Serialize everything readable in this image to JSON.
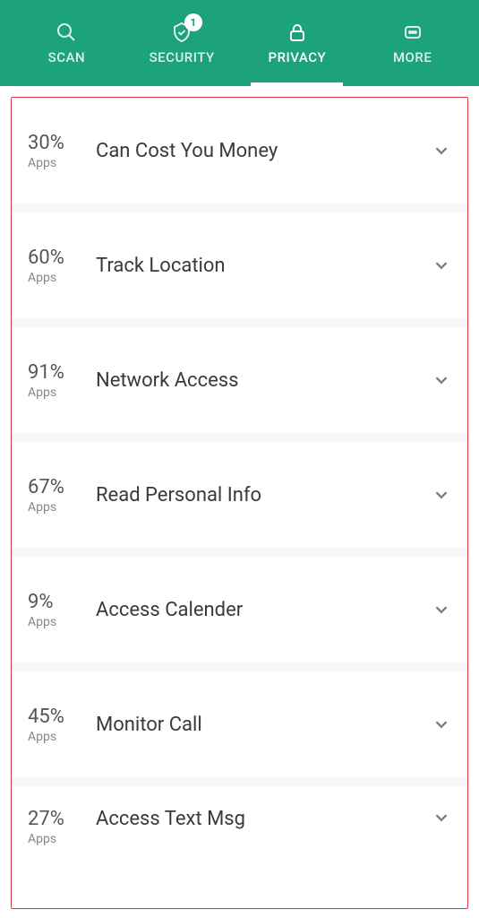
{
  "header": {
    "tabs": [
      {
        "key": "scan",
        "label": "SCAN",
        "badge": null
      },
      {
        "key": "security",
        "label": "SECURITY",
        "badge": "1"
      },
      {
        "key": "privacy",
        "label": "PRIVACY",
        "badge": null
      },
      {
        "key": "more",
        "label": "MORE",
        "badge": null
      }
    ],
    "active_tab": "privacy"
  },
  "list": {
    "apps_label": "Apps",
    "items": [
      {
        "pct": "30%",
        "title": "Can Cost You Money"
      },
      {
        "pct": "60%",
        "title": "Track Location"
      },
      {
        "pct": "91%",
        "title": "Network Access"
      },
      {
        "pct": "67%",
        "title": "Read Personal Info"
      },
      {
        "pct": "9%",
        "title": "Access Calender"
      },
      {
        "pct": "45%",
        "title": "Monitor Call"
      },
      {
        "pct": "27%",
        "title": "Access Text Msg"
      }
    ]
  },
  "colors": {
    "brand": "#1CA37A",
    "highlight_border": "#D93939"
  }
}
